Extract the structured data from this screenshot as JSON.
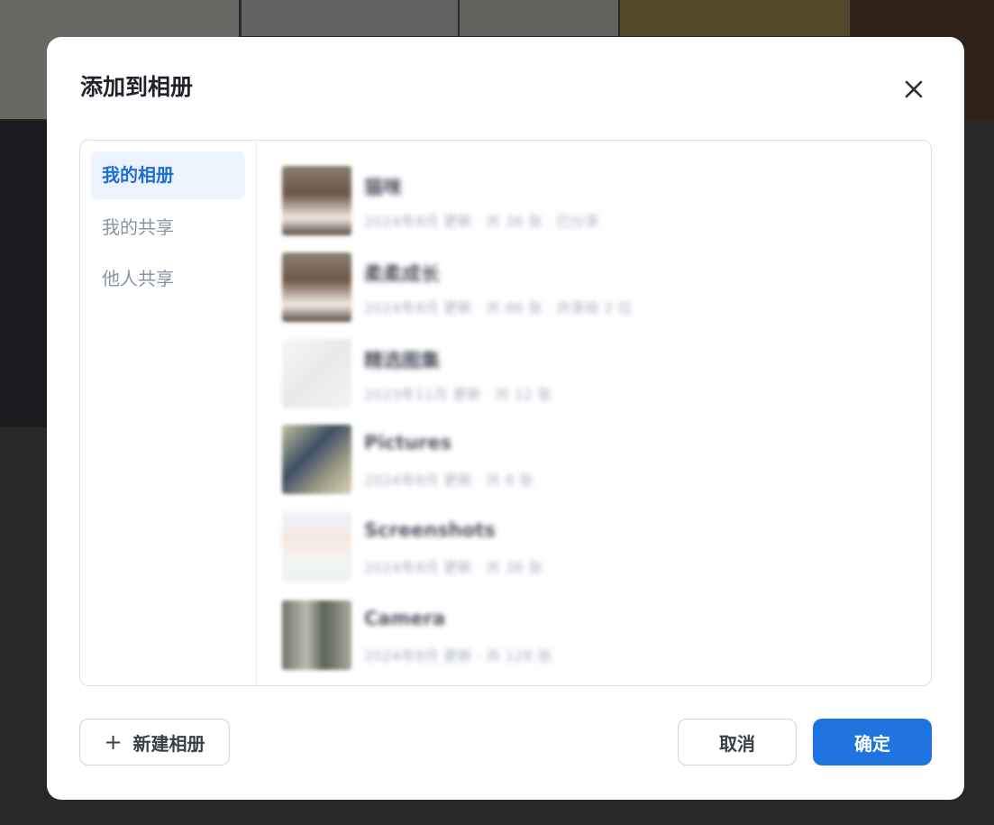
{
  "dialog": {
    "title": "添加到相册",
    "close_icon": "close-icon"
  },
  "nav": {
    "items": [
      {
        "label": "我的相册",
        "active": true
      },
      {
        "label": "我的共享",
        "active": false
      },
      {
        "label": "他人共享",
        "active": false
      }
    ]
  },
  "albums": [
    {
      "name": "猫咪",
      "meta": "2024年8月 更新 · 共 36 张 · 已分享"
    },
    {
      "name": "柔柔成长",
      "meta": "2024年8月 更新 · 共 86 张 · 共享给 2 位"
    },
    {
      "name": "精选图集",
      "meta": "2023年11月 更新 · 共 12 张"
    },
    {
      "name": "Pictures",
      "meta": "2024年8月 更新 · 共 8 张"
    },
    {
      "name": "Screenshots",
      "meta": "2024年8月 更新 · 共 38 张"
    },
    {
      "name": "Camera",
      "meta": "2024年8月 更新 · 共 128 张"
    }
  ],
  "footer": {
    "new_album_label": "新建相册",
    "cancel_label": "取消",
    "confirm_label": "确定"
  },
  "colors": {
    "accent": "#1f74e0",
    "active_nav_bg": "#edf3fc",
    "active_nav_text": "#1f6ed4"
  }
}
